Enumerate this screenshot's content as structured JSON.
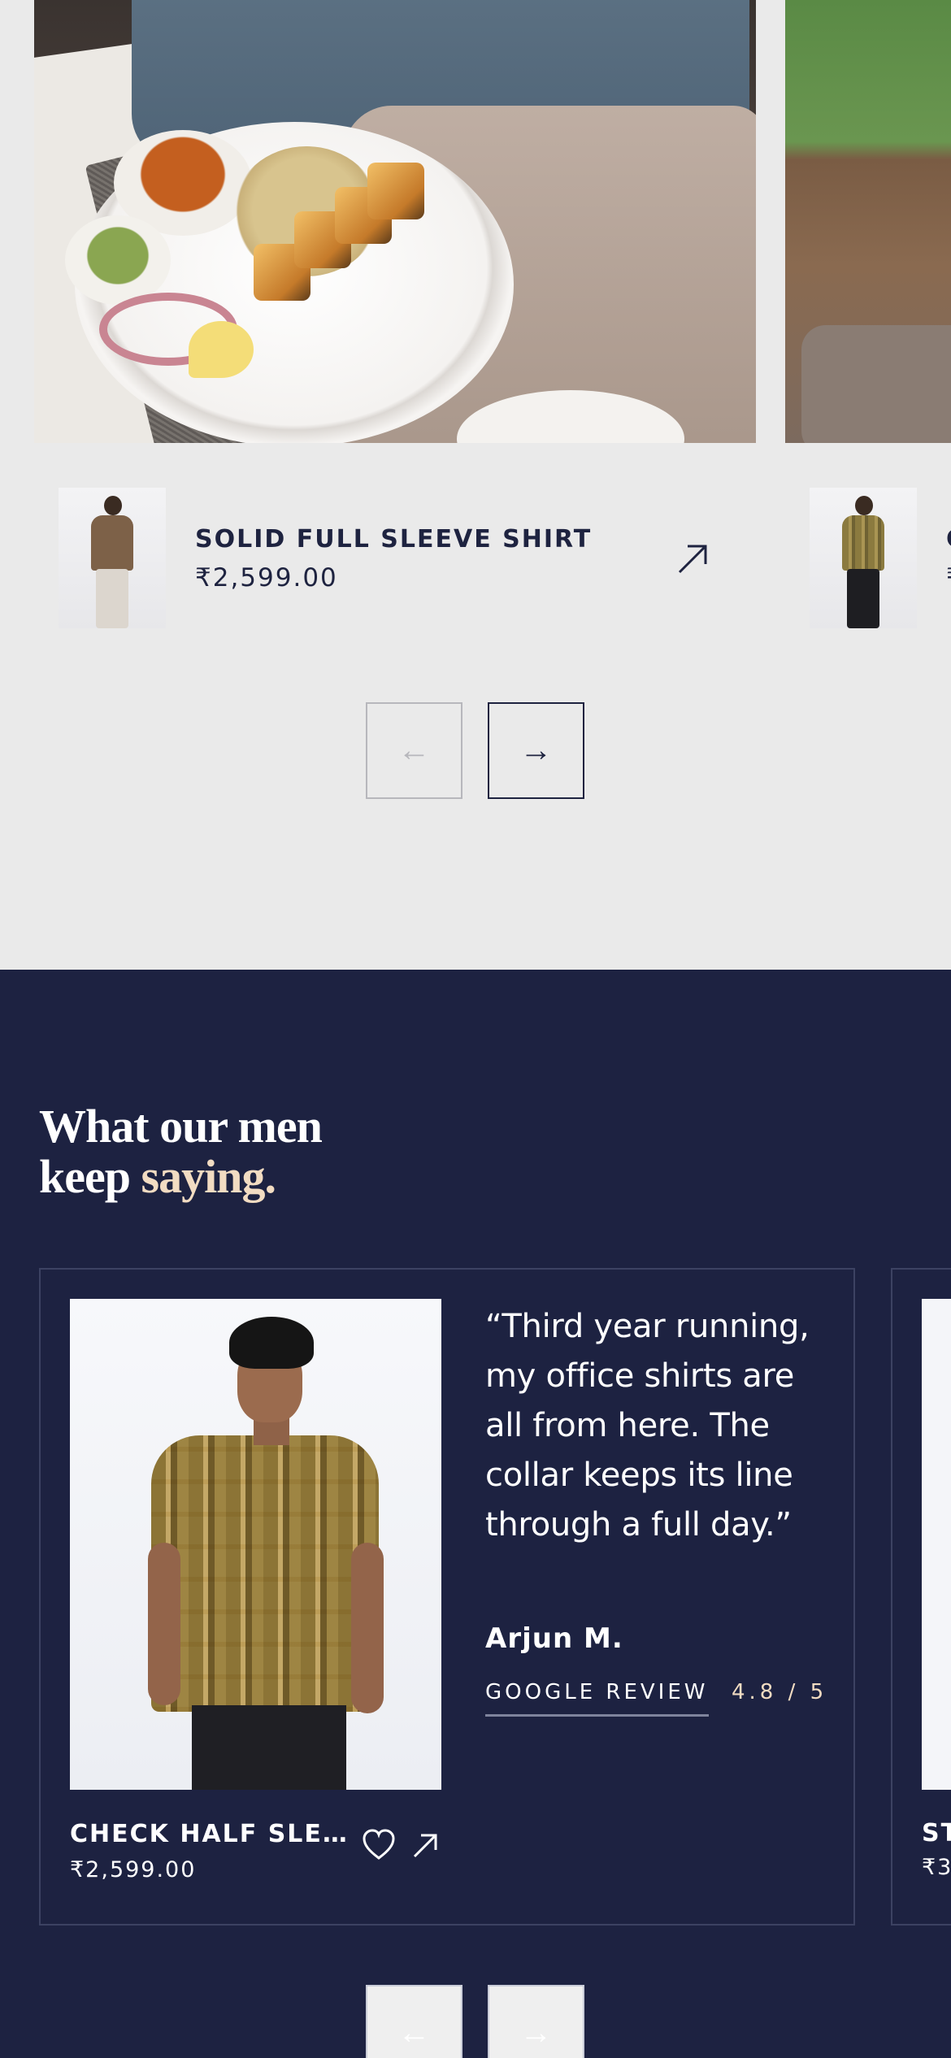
{
  "carousel": {
    "product": {
      "title": "SOLID FULL SLEEVE SHIRT",
      "price": "₹2,599.00"
    },
    "next_product_partial": {
      "title": "C",
      "price": "₹"
    },
    "prev_icon": "←",
    "next_icon": "→"
  },
  "reviews": {
    "heading_line1": "What our men",
    "heading_line2_prefix": "keep ",
    "heading_line2_accent": "saying.",
    "card": {
      "quote": "“Third year running, my office shirts are all from here. The collar keeps its line through a full day.”",
      "reviewer": "Arjun M.",
      "source": "GOOGLE REVIEW",
      "rating": "4.8 / 5",
      "product_title": "CHECK HALF SLE…",
      "product_price": "₹2,599.00"
    },
    "next_card_partial": {
      "product_title": "ST",
      "product_price": "₹3"
    },
    "prev_icon": "←",
    "next_icon": "→"
  },
  "colors": {
    "dark_bg": "#1d2241",
    "light_bg": "#eaeaea",
    "accent": "#f2dcc2",
    "navy": "#1e2340"
  },
  "icons": [
    "arrow-up-right-icon",
    "heart-icon",
    "arrow-left-icon",
    "arrow-right-icon"
  ]
}
